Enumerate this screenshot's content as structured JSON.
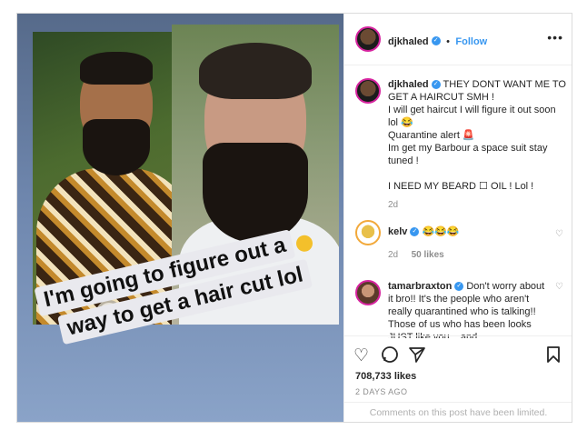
{
  "post": {
    "caption_line1": "I'm going to figure out a",
    "caption_line2": "way to get a hair cut lol"
  },
  "header": {
    "username": "djkhaled",
    "separator": "•",
    "follow_label": "Follow",
    "more_icon": "more-dots-icon"
  },
  "main_comment": {
    "username": "djkhaled",
    "lines": [
      "THEY DONT WANT ME TO GET A HAIRCUT SMH !",
      "I will get haircut I will figure it out soon lol 😂",
      "Quarantine alert 🚨",
      "Im get my Barbour a space suit stay tuned !",
      "",
      "I NEED MY BEARD ☐ OIL ! Lol !"
    ],
    "time": "2d"
  },
  "comments": [
    {
      "username": "kelv",
      "text": "😂😂😂",
      "time": "2d",
      "likes": "50 likes"
    },
    {
      "username": "tamarbraxton",
      "text": "Don't worry about it bro!! It's the people who aren't really quarantined who is talking!! Those of us who has been looks JUST like you... and"
    }
  ],
  "actions": {
    "like_icon": "heart-icon",
    "comment_icon": "comment-icon",
    "share_icon": "share-icon",
    "save_icon": "bookmark-icon"
  },
  "likes": "708,733 likes",
  "posted": "2 DAYS AGO",
  "comments_limited": "Comments on this post have been limited.",
  "colors": {
    "accent": "#3897f0",
    "verified": "#3897f0",
    "story_ring": "#d6249f"
  }
}
